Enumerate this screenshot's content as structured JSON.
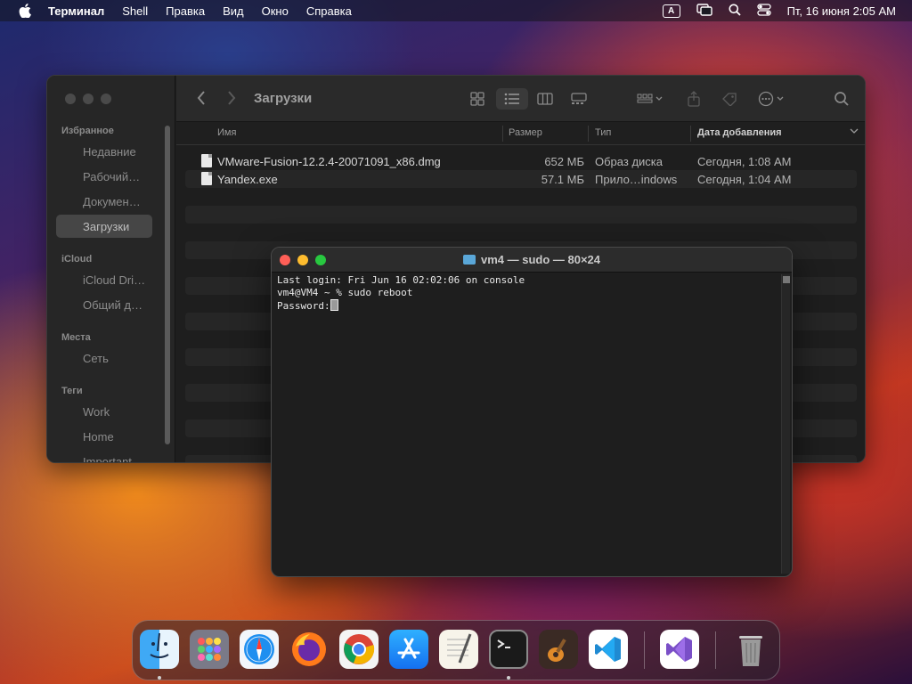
{
  "menubar": {
    "app_name": "Терминал",
    "items": [
      "Shell",
      "Правка",
      "Вид",
      "Окно",
      "Справка"
    ],
    "keyboard_layout": "A",
    "datetime": "Пт, 16 июня  2:05 AM",
    "icons": [
      "apple-logo-icon",
      "input-source-icon",
      "screen-mirroring-icon",
      "spotlight-search-icon",
      "control-center-icon"
    ]
  },
  "finder": {
    "title": "Загрузки",
    "sidebar": {
      "favorites_header": "Избранное",
      "favorites": [
        "Недавние",
        "Рабочий…",
        "Докумен…",
        "Загрузки"
      ],
      "icloud_header": "iCloud",
      "icloud": [
        "iCloud Dri…",
        "Общий д…"
      ],
      "places_header": "Места",
      "places": [
        "Сеть"
      ],
      "tags_header": "Теги",
      "tags": [
        "Work",
        "Home",
        "Important"
      ]
    },
    "columns": {
      "name": "Имя",
      "size": "Размер",
      "kind": "Тип",
      "date_added": "Дата добавления"
    },
    "files": [
      {
        "name": "VMware-Fusion-12.2.4-20071091_x86.dmg",
        "size": "652 МБ",
        "kind": "Образ диска",
        "date": "Сегодня, 1:08 AM"
      },
      {
        "name": "Yandex.exe",
        "size": "57.1 МБ",
        "kind": "Прило…indows",
        "date": "Сегодня, 1:04 AM"
      }
    ]
  },
  "terminal": {
    "title": "vm4 — sudo — 80×24",
    "lines": [
      "Last login: Fri Jun 16 02:02:06 on console",
      "vm4@VM4 ~ % sudo reboot",
      "Password:"
    ]
  },
  "dock": {
    "apps": [
      {
        "name": "finder-icon",
        "running": true
      },
      {
        "name": "launchpad-icon",
        "running": false
      },
      {
        "name": "safari-icon",
        "running": false
      },
      {
        "name": "firefox-icon",
        "running": false
      },
      {
        "name": "chrome-icon",
        "running": false
      },
      {
        "name": "app-store-icon",
        "running": false
      },
      {
        "name": "textedit-icon",
        "running": false
      },
      {
        "name": "terminal-icon",
        "running": true
      },
      {
        "name": "garageband-icon",
        "running": false
      },
      {
        "name": "vscode-icon",
        "running": false
      },
      {
        "name": "visual-studio-icon",
        "running": false
      },
      {
        "name": "trash-icon",
        "running": false
      }
    ]
  }
}
